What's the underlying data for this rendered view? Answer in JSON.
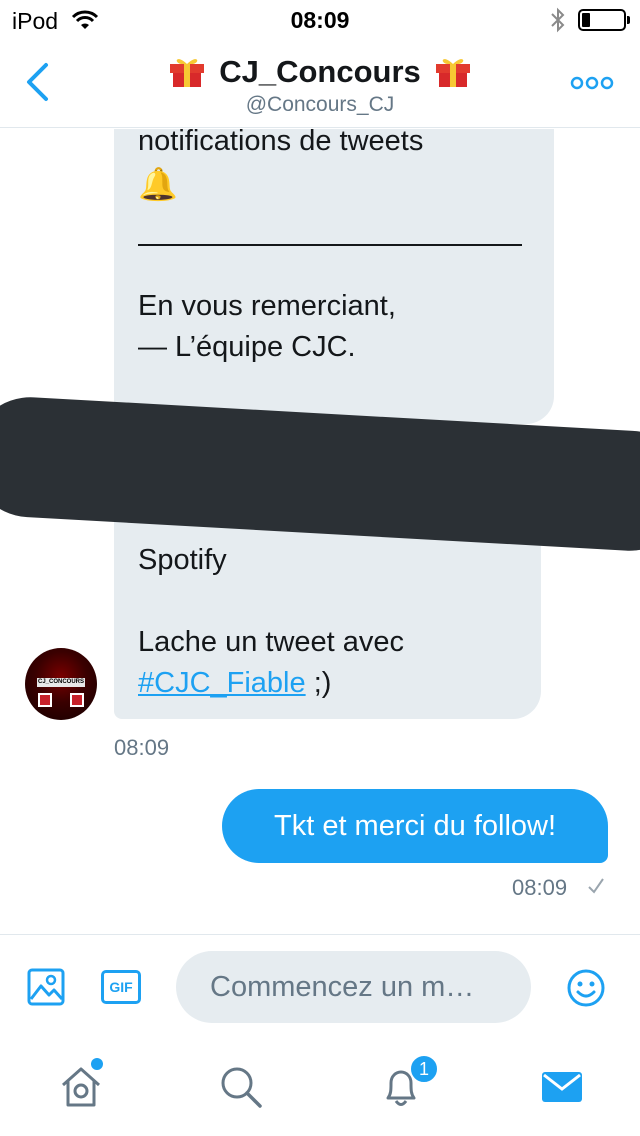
{
  "status_bar": {
    "carrier": "iPod",
    "time": "08:09"
  },
  "header": {
    "title": "CJ_Concours",
    "handle": "@Concours_CJ",
    "title_icon": "gift-emoji",
    "accent_color": "#1da1f2"
  },
  "conversation": {
    "incoming_a": {
      "lines": [
        "notifications de tweets",
        "En vous remerciant,",
        "— L’équipe CJC."
      ],
      "emoji": "🔔"
    },
    "incoming_b": {
      "lines": [
        "Spotify",
        "Lache un tweet avec"
      ],
      "hashtag": "#CJC_Fiable",
      "suffix": " ;)"
    },
    "avatar_label": "CJ_CONCOURS",
    "incoming_time": "08:09",
    "outgoing": {
      "text": "Tkt et merci du follow!",
      "time": "08:09"
    },
    "redaction_color": "#2b3035",
    "bubble_in_color": "#e6ecf0",
    "bubble_out_color": "#1da1f2"
  },
  "composer": {
    "gif_label": "GIF",
    "placeholder": "Commencez un m…"
  },
  "tabbar": {
    "items": [
      "home-icon",
      "search-icon",
      "notifications-icon",
      "messages-icon"
    ],
    "notification_count": "1"
  }
}
